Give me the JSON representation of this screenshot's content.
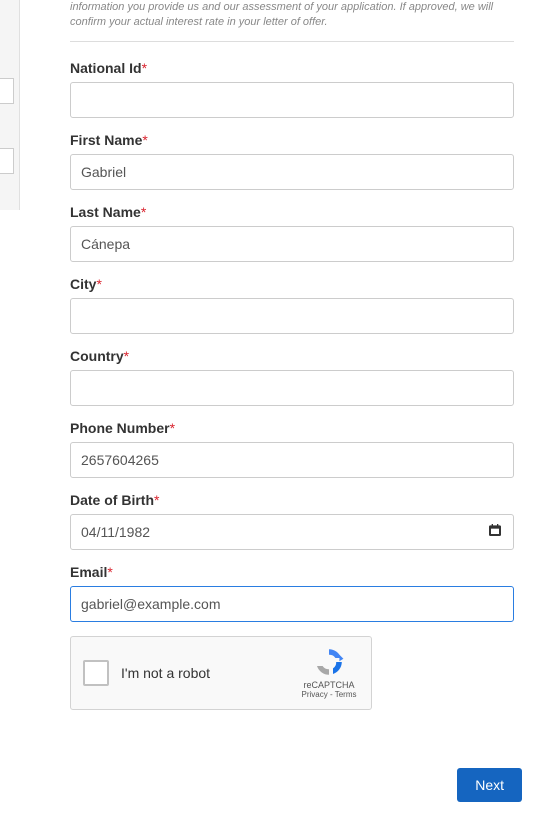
{
  "disclaimer": "information you provide us and our assessment of your application. If approved, we will confirm your actual interest rate in your letter of offer.",
  "fields": {
    "national_id": {
      "label": "National Id",
      "value": ""
    },
    "first_name": {
      "label": "First Name",
      "value": "Gabriel"
    },
    "last_name": {
      "label": "Last Name",
      "value": "Cánepa"
    },
    "city": {
      "label": "City",
      "value": ""
    },
    "country": {
      "label": "Country",
      "value": ""
    },
    "phone": {
      "label": "Phone Number",
      "value": "2657604265"
    },
    "dob": {
      "label": "Date of Birth",
      "value": "04/11/1982"
    },
    "email": {
      "label": "Email",
      "value": "gabriel@example.com"
    }
  },
  "recaptcha": {
    "label": "I'm not a robot",
    "brand": "reCAPTCHA",
    "links": "Privacy - Terms"
  },
  "buttons": {
    "next": "Next"
  },
  "required_mark": "*"
}
